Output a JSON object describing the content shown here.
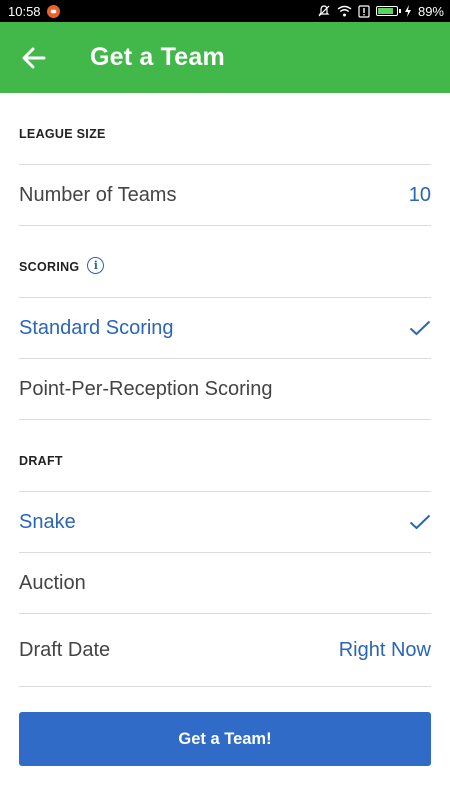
{
  "status_bar": {
    "time": "10:58",
    "battery_percent": "89%",
    "battery_level": 0.89
  },
  "app_bar": {
    "title": "Get a Team"
  },
  "league_size": {
    "header": "LEAGUE SIZE",
    "number_of_teams_label": "Number of Teams",
    "number_of_teams_value": "10"
  },
  "scoring": {
    "header": "SCORING",
    "options": [
      {
        "label": "Standard Scoring",
        "selected": true
      },
      {
        "label": "Point-Per-Reception Scoring",
        "selected": false
      }
    ]
  },
  "draft": {
    "header": "DRAFT",
    "options": [
      {
        "label": "Snake",
        "selected": true
      },
      {
        "label": "Auction",
        "selected": false
      }
    ],
    "date_label": "Draft Date",
    "date_value": "Right Now"
  },
  "primary_button": {
    "label": "Get a Team!"
  },
  "colors": {
    "app_bar": "#43b84a",
    "accent_blue": "#2a65b8",
    "button_blue": "#2f6bc7"
  }
}
